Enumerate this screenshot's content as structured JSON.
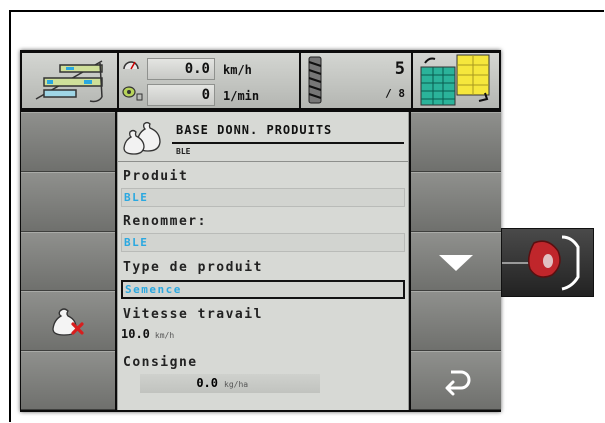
{
  "header": {
    "speed_value": "0.0",
    "speed_unit": "km/h",
    "rpm_value": "0",
    "rpm_unit": "1/min",
    "section_count": "5",
    "section_total": "/ 8"
  },
  "panel": {
    "title": "BASE DONN. PRODUITS",
    "subtitle": "BLE",
    "fields": {
      "produit_label": "Produit",
      "produit_value": "BLE",
      "renommer_label": "Renommer:",
      "renommer_value": "BLE",
      "type_label": "Type de produit",
      "type_value": "Semence",
      "vitesse_label": "Vitesse travail",
      "vitesse_value": "10.0",
      "vitesse_unit": "km/h",
      "consigne_label": "Consigne",
      "consigne_value": "0.0",
      "consigne_unit": "kg/ha"
    }
  },
  "colors": {
    "value_text": "#2aa8e0",
    "delete_mark": "#d81e1e",
    "knob": "#c0262b"
  },
  "icons": {
    "delete_button": "bag-delete-icon",
    "scroll_down": "triangle-down-icon",
    "back_button": "return-arrow-icon"
  }
}
